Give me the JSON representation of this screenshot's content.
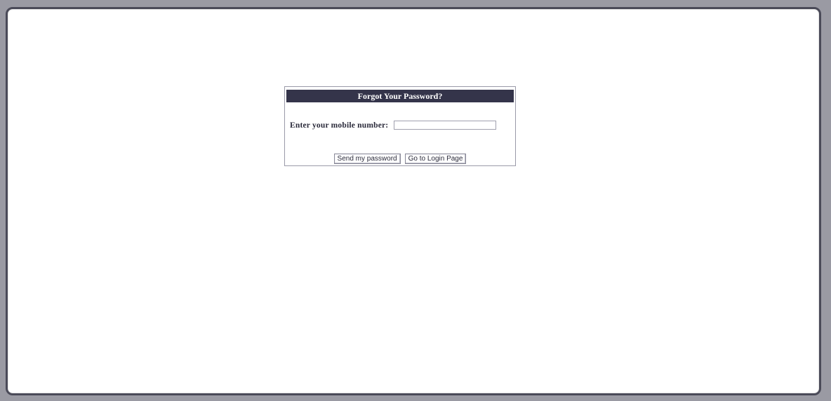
{
  "forgot_password": {
    "title": "Forgot Your Password?",
    "mobile_label": "Enter your mobile number:",
    "mobile_value": "",
    "send_button": "Send my password",
    "login_button": "Go to Login Page"
  },
  "colors": {
    "header_bg": "#34344a",
    "header_text": "#ffffff",
    "frame_border": "#4a4a58"
  }
}
